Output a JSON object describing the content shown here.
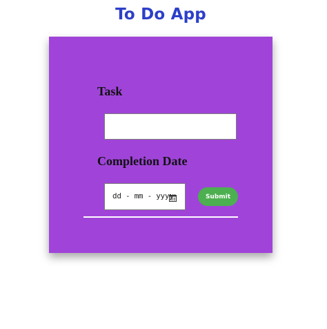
{
  "app": {
    "title": "To Do App"
  },
  "form": {
    "task_label": "Task",
    "task_value": "",
    "date_label": "Completion Date",
    "date_placeholder": "dd - mm - yyyy",
    "submit_label": "Submit"
  },
  "colors": {
    "title": "#2d3fc8",
    "card_background": "#a044d9",
    "submit_button": "#4caf50"
  },
  "icons": {
    "date_picker": "calendar-icon"
  }
}
